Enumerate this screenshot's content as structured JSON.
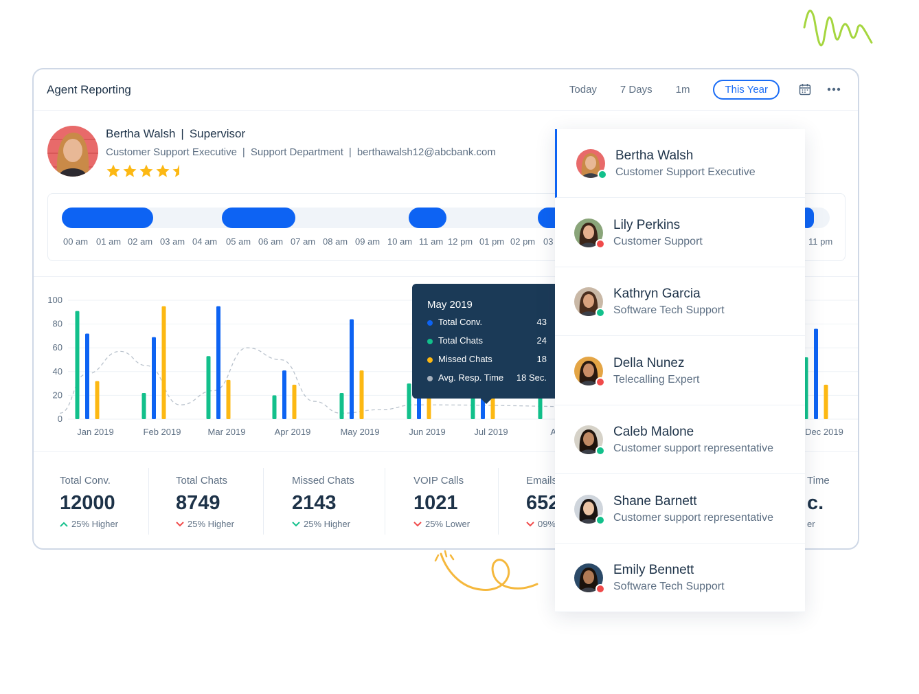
{
  "header": {
    "title": "Agent Reporting",
    "filters": [
      "Today",
      "7 Days",
      "1m",
      "This Year"
    ],
    "active_filter": "This Year"
  },
  "profile": {
    "name": "Bertha Walsh",
    "title": "Supervisor",
    "role": "Customer Support Executive",
    "department": "Support Department",
    "email": "berthawalsh12@abcbank.com",
    "rating": 4.5
  },
  "timeline": {
    "hours": [
      "00 am",
      "01 am",
      "02 am",
      "03 am",
      "04 am",
      "05 am",
      "06 am",
      "07 am",
      "08 am",
      "09 am",
      "10 am",
      "11 am",
      "12 pm",
      "01 pm",
      "02 pm",
      "03",
      "11 pm"
    ]
  },
  "chart_data": {
    "type": "bar",
    "categories": [
      "Jan 2019",
      "Feb 2019",
      "Mar 2019",
      "Apr 2019",
      "May 2019",
      "Jun 2019",
      "Jul 2019",
      "Aug",
      "Dec 2019"
    ],
    "yticks": [
      0,
      20,
      40,
      60,
      80,
      100
    ],
    "ylim": [
      0,
      100
    ],
    "grid": true,
    "series": [
      {
        "color": "#12c08b",
        "values": [
          91,
          22,
          53,
          20,
          22,
          30,
          20,
          40,
          52
        ]
      },
      {
        "color": "#0d63f3",
        "values": [
          72,
          69,
          95,
          41,
          84,
          35,
          35,
          0,
          76
        ]
      },
      {
        "color": "#fcb813",
        "values": [
          32,
          95,
          33,
          29,
          41,
          30,
          18,
          0,
          29
        ]
      }
    ],
    "trend_line": [
      {
        "x": 0.0,
        "y": 5
      },
      {
        "x": 0.4,
        "y": 38
      },
      {
        "x": 0.9,
        "y": 57
      },
      {
        "x": 1.3,
        "y": 45
      },
      {
        "x": 1.8,
        "y": 12
      },
      {
        "x": 2.3,
        "y": 24
      },
      {
        "x": 2.8,
        "y": 60
      },
      {
        "x": 3.3,
        "y": 50
      },
      {
        "x": 3.8,
        "y": 15
      },
      {
        "x": 4.2,
        "y": 5
      },
      {
        "x": 4.8,
        "y": 8
      },
      {
        "x": 5.3,
        "y": 12
      },
      {
        "x": 8.8,
        "y": 10
      },
      {
        "x": 9.3,
        "y": 2
      }
    ]
  },
  "tooltip": {
    "title": "May 2019",
    "rows": [
      {
        "label": "Total Conv.",
        "value": "43",
        "color": "#0d63f3"
      },
      {
        "label": "Total Chats",
        "value": "24",
        "color": "#12c08b"
      },
      {
        "label": "Missed Chats",
        "value": "18",
        "color": "#fcb813"
      },
      {
        "label": "Avg. Resp. Time",
        "value": "18 Sec.",
        "color": "#a7b1bd"
      }
    ]
  },
  "kpis": [
    {
      "label": "Total Conv.",
      "value": "12000",
      "trend": "25% Higher",
      "direction": "up"
    },
    {
      "label": "Total Chats",
      "value": "8749",
      "trend": "25% Higher",
      "direction": "down"
    },
    {
      "label": "Missed Chats",
      "value": "2143",
      "trend": "25% Higher",
      "direction": "down-green"
    },
    {
      "label": "VOIP Calls",
      "value": "1021",
      "trend": "25% Lower",
      "direction": "down"
    },
    {
      "label": "Emails",
      "value": "652",
      "trend": "09%",
      "direction": "down"
    },
    {
      "label": "Time",
      "value": "c.",
      "trend": "er",
      "direction": "none"
    }
  ],
  "agents": [
    {
      "name": "Bertha Walsh",
      "role": "Customer Support Executive",
      "status": "online",
      "status_color": "#12c08b",
      "skin": "#e8b896",
      "hair": "#c98a48",
      "bg": "#e86a6a",
      "selected": true
    },
    {
      "name": "Lily Perkins",
      "role": "Customer Support",
      "status": "busy",
      "status_color": "#f04a4a",
      "skin": "#e4b08f",
      "hair": "#3a2418",
      "bg": "#8aa57a",
      "selected": false
    },
    {
      "name": "Kathryn Garcia",
      "role": "Software Tech Support",
      "status": "online",
      "status_color": "#12c08b",
      "skin": "#d9a27e",
      "hair": "#4a2d1d",
      "bg": "#c9b8a6",
      "selected": false
    },
    {
      "name": "Della Nunez",
      "role": "Telecalling Expert",
      "status": "busy",
      "status_color": "#f04a4a",
      "skin": "#c98d66",
      "hair": "#2a1a10",
      "bg": "#e4a545",
      "selected": false
    },
    {
      "name": "Caleb Malone",
      "role": "Customer support representative",
      "status": "online",
      "status_color": "#12c08b",
      "skin": "#c08a64",
      "hair": "#1f140d",
      "bg": "#d6d2c8",
      "selected": false
    },
    {
      "name": "Shane Barnett",
      "role": "Customer support representative",
      "status": "online",
      "status_color": "#12c08b",
      "skin": "#ecc4a4",
      "hair": "#1a1412",
      "bg": "#cfd5dc",
      "selected": false
    },
    {
      "name": "Emily Bennett",
      "role": "Software Tech Support",
      "status": "busy",
      "status_color": "#f04a4a",
      "skin": "#b07a55",
      "hair": "#1a120c",
      "bg": "#2b4a68",
      "selected": false
    }
  ]
}
